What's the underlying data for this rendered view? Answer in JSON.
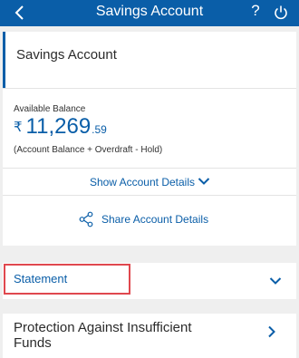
{
  "header": {
    "title": "Savings Account",
    "help_symbol": "?"
  },
  "account": {
    "name": "Savings Account",
    "available_balance_label": "Available Balance",
    "currency_symbol": "₹",
    "balance_whole": "11,269",
    "balance_decimal": ".59",
    "balance_note": "(Account Balance + Overdraft - Hold)"
  },
  "actions": {
    "show_details_label": "Show Account Details",
    "share_details_label": "Share Account Details"
  },
  "sections": {
    "statement_label": "Statement",
    "insufficient_funds_label": "Protection Against Insufficient Funds"
  },
  "colors": {
    "brand": "#0a5ea8",
    "highlight": "#e0484e",
    "background": "#efefef"
  }
}
